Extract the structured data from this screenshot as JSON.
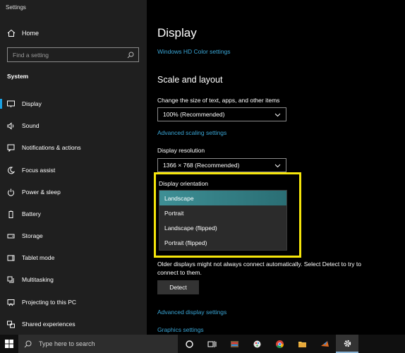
{
  "app": {
    "title": "Settings"
  },
  "sidebar": {
    "home_label": "Home",
    "search_placeholder": "Find a setting",
    "section_title": "System",
    "items": [
      {
        "label": "Display",
        "icon": "monitor-icon",
        "active": true
      },
      {
        "label": "Sound",
        "icon": "speaker-icon"
      },
      {
        "label": "Notifications & actions",
        "icon": "notification-icon"
      },
      {
        "label": "Focus assist",
        "icon": "moon-icon"
      },
      {
        "label": "Power & sleep",
        "icon": "power-icon"
      },
      {
        "label": "Battery",
        "icon": "battery-icon"
      },
      {
        "label": "Storage",
        "icon": "storage-icon"
      },
      {
        "label": "Tablet mode",
        "icon": "tablet-icon"
      },
      {
        "label": "Multitasking",
        "icon": "multitasking-icon"
      },
      {
        "label": "Projecting to this PC",
        "icon": "projector-icon"
      },
      {
        "label": "Shared experiences",
        "icon": "shared-icon"
      }
    ]
  },
  "main": {
    "title": "Display",
    "hd_color_link": "Windows HD Color settings",
    "scale_heading": "Scale and layout",
    "scale_label": "Change the size of text, apps, and other items",
    "scale_value": "100% (Recommended)",
    "advanced_scaling_link": "Advanced scaling settings",
    "resolution_label": "Display resolution",
    "resolution_value": "1366 × 768 (Recommended)",
    "orientation_label": "Display orientation",
    "orientation_options": [
      "Landscape",
      "Portrait",
      "Landscape (flipped)",
      "Portrait (flipped)"
    ],
    "orientation_selected": "Landscape",
    "detect_text": "Older displays might not always connect automatically. Select Detect to try to connect to them.",
    "detect_button": "Detect",
    "advanced_display_link": "Advanced display settings",
    "graphics_link": "Graphics settings"
  },
  "taskbar": {
    "search_placeholder": "Type here to search",
    "icons": [
      "cortana-icon",
      "task-view-icon",
      "app-icon-1",
      "app-icon-2",
      "chrome-icon",
      "file-explorer-icon",
      "matlab-icon",
      "settings-icon"
    ]
  },
  "colors": {
    "accent": "#1ba1e2",
    "link": "#3aa6d6",
    "highlight": "#f5e50b",
    "selected": "#3e8f95"
  }
}
